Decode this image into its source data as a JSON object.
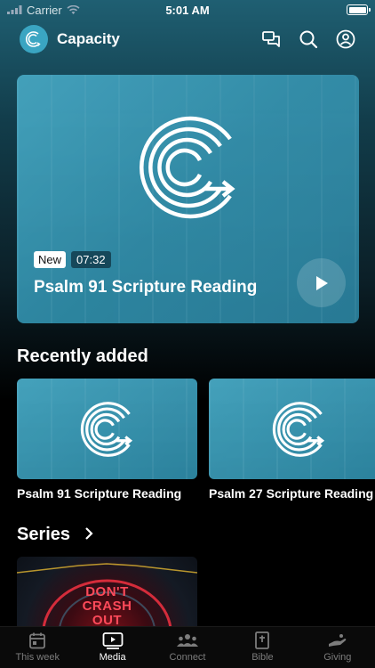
{
  "status": {
    "carrier": "Carrier",
    "time": "5:01 AM",
    "battery_level": 1.0
  },
  "header": {
    "app_name": "Capacity"
  },
  "featured": {
    "badge": "New",
    "duration": "07:32",
    "title": "Psalm 91 Scripture Reading"
  },
  "recent": {
    "title": "Recently added",
    "items": [
      {
        "title": "Psalm 91 Scripture Reading"
      },
      {
        "title": "Psalm 27 Scripture Reading"
      }
    ]
  },
  "series": {
    "title": "Series",
    "card_text_1": "DON'T",
    "card_text_2": "CRASH",
    "card_text_3": "OUT"
  },
  "tabs": [
    {
      "label": "This week"
    },
    {
      "label": "Media"
    },
    {
      "label": "Connect"
    },
    {
      "label": "Bible"
    },
    {
      "label": "Giving"
    }
  ],
  "colors": {
    "accent": "#3aa5c2",
    "active_tab": "#ffffff",
    "inactive_tab": "#7c7c7c"
  }
}
